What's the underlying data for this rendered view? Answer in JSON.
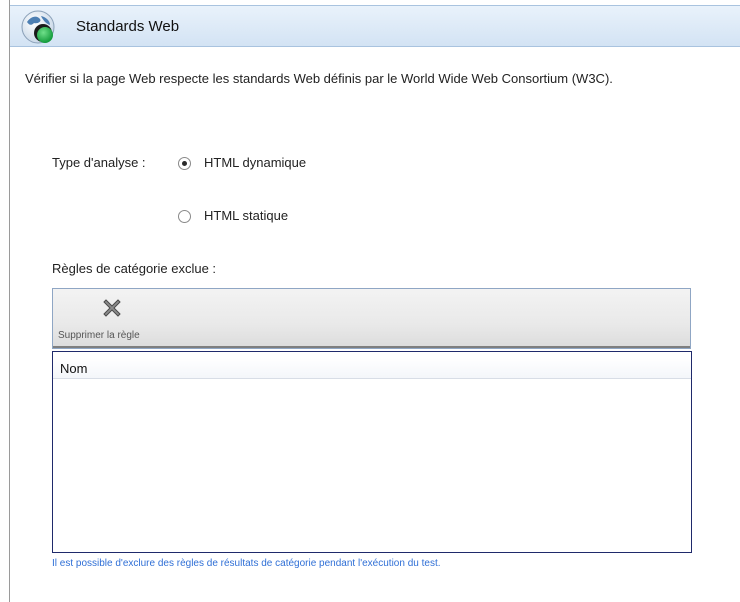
{
  "header": {
    "title": "Standards Web",
    "icon": "globe-check-icon"
  },
  "description": "Vérifier si la page Web respecte les standards Web définis par le World Wide Web Consortium (W3C).",
  "analysis": {
    "label": "Type d'analyse :",
    "options": [
      {
        "label": "HTML dynamique",
        "selected": true
      },
      {
        "label": "HTML statique",
        "selected": false
      }
    ]
  },
  "rules": {
    "label": "Règles de catégorie exclue :",
    "toolbar": {
      "delete_label": "Supprimer la règle",
      "delete_icon": "close-x-icon"
    },
    "table": {
      "columns": [
        "Nom"
      ],
      "rows": []
    }
  },
  "hint": "Il est possible d'exclure des règles de résultats de catégorie pendant l'exécution du test.",
  "colors": {
    "header_bg": "#dbe8f6",
    "table_border": "#1f2a6b",
    "hint_text": "#2f6fd6"
  }
}
